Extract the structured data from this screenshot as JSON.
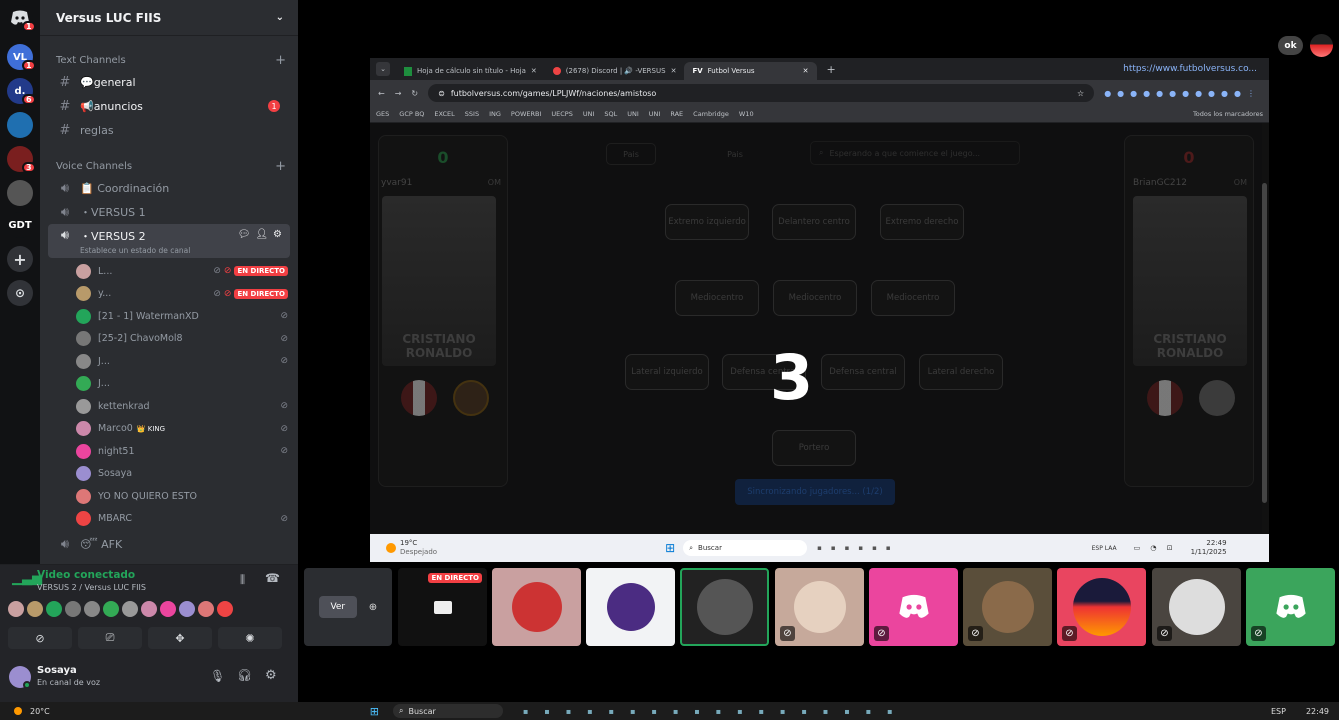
{
  "server": {
    "name": "Versus LUC FIIS",
    "rail": [
      {
        "label": "",
        "color": "#5865f2",
        "badge": "1"
      },
      {
        "label": "VL",
        "color": "#3f6fd8",
        "badge": "1"
      },
      {
        "label": "d.",
        "color": "#223a8a",
        "badge": "6"
      },
      {
        "label": "",
        "color": "#1f6fb0",
        "badge": ""
      },
      {
        "label": "",
        "color": "#7a1f1f",
        "badge": "3"
      },
      {
        "label": "",
        "color": "#666",
        "badge": ""
      },
      {
        "label": "GDT",
        "color": "#111214",
        "badge": ""
      }
    ]
  },
  "text_channels": {
    "header": "Text Channels",
    "items": [
      {
        "name": "💬general",
        "unread": true,
        "badge": ""
      },
      {
        "name": "📢anuncios",
        "unread": true,
        "badge": "1"
      },
      {
        "name": "reglas",
        "unread": false,
        "badge": ""
      }
    ]
  },
  "voice_channels": {
    "header": "Voice Channels",
    "coordinacion": "📋 Coordinación",
    "versus1": "・VERSUS 1",
    "versus2": "・VERSUS 2",
    "status_hint": "Establece un estado de canal",
    "afk": "😴 AFK"
  },
  "live_label": "EN DIRECTO",
  "voice_users": [
    {
      "name": "L...",
      "color": "#c9a0a0",
      "live": true
    },
    {
      "name": "y...",
      "color": "#b89a6a",
      "live": true
    },
    {
      "name": "[21 - 1] WatermanXD",
      "color": "#23a55a",
      "live": false
    },
    {
      "name": "[25-2] ChavoMol8",
      "color": "#777",
      "live": false
    },
    {
      "name": "J...",
      "color": "#888",
      "live": false
    },
    {
      "name": "J...",
      "color": "#3a5",
      "live": false
    },
    {
      "name": "kettenkrad",
      "color": "#999",
      "live": false
    },
    {
      "name": "Marco0",
      "color": "#c8a",
      "live": false,
      "tag": "👑 KING"
    },
    {
      "name": "night51",
      "color": "#eb459e",
      "live": false
    },
    {
      "name": "Sosaya",
      "color": "#9b8ed0",
      "live": false
    },
    {
      "name": "YO NO QUIERO ESTO",
      "color": "#d77",
      "live": false
    },
    {
      "name": "MBARC",
      "color": "#e44",
      "live": false
    }
  ],
  "voice_panel": {
    "status": "Video conectado",
    "sub": "VERSUS 2 / Versus LUC FIIS"
  },
  "user_panel": {
    "name": "Sosaya",
    "sub": "En canal de voz"
  },
  "share": {
    "tabs": [
      "Hoja de cálculo sin título - Hoja",
      "(2678) Discord | 🔊 -VERSUS",
      "Futbol Versus"
    ],
    "url": "futbolversus.com/games/LPLJWf/naciones/amistoso",
    "tooltip": "https://www.futbolversus.co...",
    "bookmarks": [
      "GES",
      "GCP BQ",
      "EXCEL",
      "SSIS",
      "ING",
      "POWERBI",
      "UECPS",
      "UNI",
      "SQL",
      "UNI",
      "UNI",
      "RAE",
      "Cambridge",
      "W10",
      "Todos los marcadores"
    ],
    "player_left": {
      "name": "yvar91",
      "score": "0",
      "role": "OM"
    },
    "player_right": {
      "name": "BrianGC212",
      "score": "0",
      "role": "OM"
    },
    "card_name": "CRISTIANO RONALDO",
    "tabs_game": [
      "Pais",
      "Pais"
    ],
    "search_placeholder": "Esperando a que comience el juego...",
    "positions": [
      "Extremo izquierdo",
      "Delantero centro",
      "Extremo derecho",
      "Mediocentro",
      "Mediocentro",
      "Mediocentro",
      "Lateral izquierdo",
      "Defensa central",
      "Defensa central",
      "Lateral derecho",
      "Portero"
    ],
    "countdown": "3",
    "sync": "Sincronizando jugadores... (1/2)",
    "weather_temp": "19°C",
    "weather_desc": "Despejado",
    "search": "Buscar",
    "time": "22:49",
    "date": "1/11/2025",
    "lang": "ESP LAA"
  },
  "tiles": {
    "ver": "Ver"
  },
  "ok": "ok",
  "taskbar": {
    "temp": "20°C",
    "search": "Buscar",
    "lang": "ESP",
    "time": "22:49"
  }
}
